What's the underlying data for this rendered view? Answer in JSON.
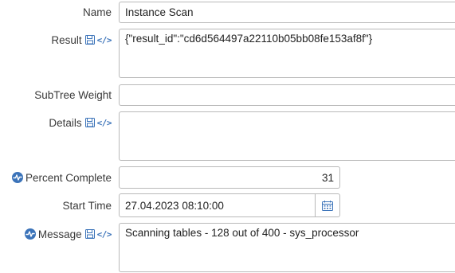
{
  "fields": {
    "name": {
      "label": "Name",
      "value": "Instance Scan"
    },
    "result": {
      "label": "Result",
      "value": "{\"result_id\":\"cd6d564497a22110b05bb08fe153af8f\"}"
    },
    "subtree_weight": {
      "label": "SubTree Weight",
      "value": ""
    },
    "details": {
      "label": "Details",
      "value": ""
    },
    "percent_complete": {
      "label": "Percent Complete",
      "value": "31"
    },
    "start_time": {
      "label": "Start Time",
      "value": "27.04.2023 08:10:00"
    },
    "message": {
      "label": "Message",
      "value": "Scanning tables - 128 out of 400 - sys_processor"
    }
  },
  "icons": {
    "save": "save-icon",
    "code": "code-icon",
    "code_glyph": "</>",
    "pulse": "activity-icon",
    "calendar": "calendar-icon"
  },
  "colors": {
    "accent": "#3b73b9",
    "border": "#b9b9b9"
  }
}
